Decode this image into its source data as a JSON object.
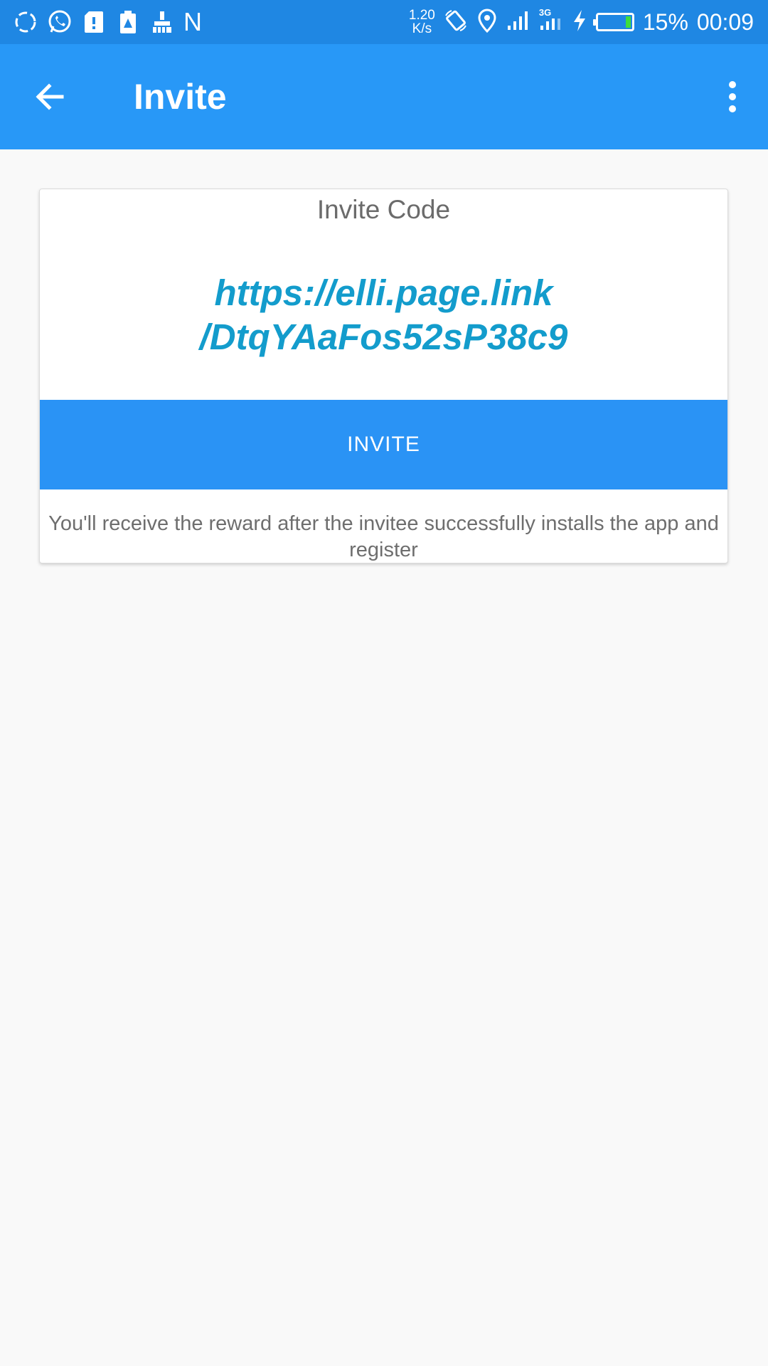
{
  "status_bar": {
    "left_icons": [
      "sync-icon",
      "whatsapp-icon",
      "sd-card-icon",
      "alert-battery-icon",
      "cleaner-broom-icon"
    ],
    "left_letter": "N",
    "net_speed_value": "1.20",
    "net_speed_unit": "K/s",
    "network_label": "3G",
    "battery_percent": "15%",
    "battery_level": 0.15,
    "time": "00:09"
  },
  "app_bar": {
    "title": "Invite",
    "back_icon": "arrow-back-icon",
    "menu_icon": "more-vertical-icon"
  },
  "card": {
    "label": "Invite Code",
    "link_line1": "https://elli.page.link",
    "link_line2": "/DtqYAaFos52sP38c9",
    "button_label": "INVITE",
    "note": "You'll receive the reward after the invitee successfully installs the app and register"
  },
  "colors": {
    "status_bar": "#1f87e3",
    "app_bar": "#2898f7",
    "button": "#2a93f5",
    "link": "#139ccc",
    "background": "#f9f9f9"
  }
}
